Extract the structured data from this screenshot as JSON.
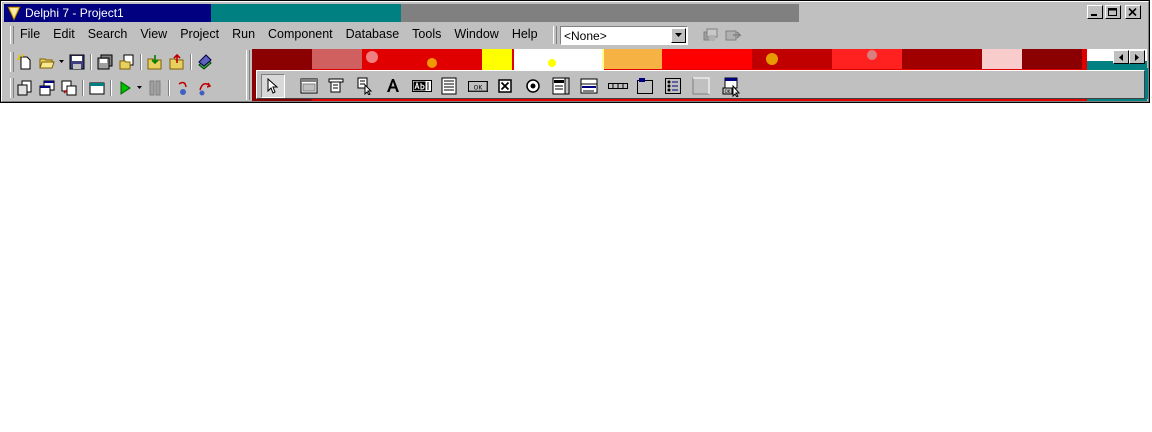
{
  "window": {
    "title": "Delphi 7 - Project1",
    "colors": {
      "active_title": "#000080",
      "accent": "#008080",
      "inactive": "#808080",
      "face": "#c0c0c0"
    }
  },
  "menu": {
    "items": [
      "File",
      "Edit",
      "Search",
      "View",
      "Project",
      "Run",
      "Component",
      "Database",
      "Tools",
      "Window",
      "Help"
    ]
  },
  "desktop_combo": {
    "value": "<None>"
  },
  "icons": {
    "caption": [
      "minimize-icon",
      "maximize-icon",
      "close-icon"
    ],
    "standard_row1": [
      "new-items-icon",
      "open-icon",
      "save-icon",
      "save-all-icon",
      "open-project-icon",
      "add-file-icon",
      "remove-file-icon",
      "help-icon"
    ],
    "standard_row2": [
      "view-unit-icon",
      "view-form-icon",
      "toggle-form-unit-icon",
      "new-form-icon",
      "run-icon",
      "pause-icon",
      "trace-into-icon",
      "step-over-icon"
    ],
    "palette": [
      "pointer-icon",
      "frames-icon",
      "main-menu-icon",
      "popup-menu-icon",
      "label-icon",
      "edit-icon",
      "memo-icon",
      "button-icon",
      "checkbox-icon",
      "radio-button-icon",
      "listbox-icon",
      "combobox-icon",
      "scrollbar-icon",
      "groupbox-icon",
      "radiogroup-icon",
      "panel-icon",
      "action-list-icon"
    ]
  }
}
